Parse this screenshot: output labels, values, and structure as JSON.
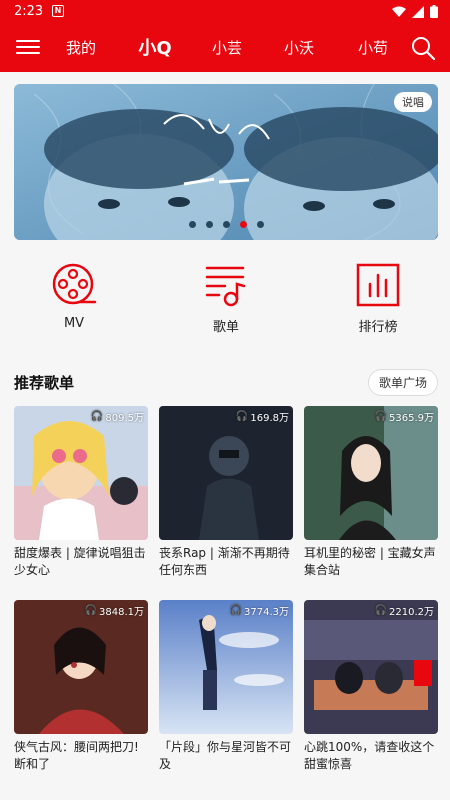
{
  "status": {
    "time": "2:23",
    "notif_glyph": "N"
  },
  "nav": {
    "tabs": [
      "我的",
      "小Q",
      "小芸",
      "小沃",
      "小苟"
    ],
    "active_tab": "小Q"
  },
  "banner": {
    "badge": "说唱",
    "dots": 5,
    "active_dot": 3
  },
  "quick_links": [
    {
      "label": "MV",
      "icon": "film-reel-icon"
    },
    {
      "label": "歌单",
      "icon": "playlist-icon"
    },
    {
      "label": "排行榜",
      "icon": "chart-icon"
    }
  ],
  "recommend": {
    "title": "推荐歌单",
    "more_label": "歌单广场",
    "playlists": [
      {
        "title": "甜度爆表 | 旋律说唱狙击少女心",
        "plays": "809.5万",
        "palette": [
          "#c8d6e8",
          "#e7c0c8"
        ]
      },
      {
        "title": "丧系Rap | 渐渐不再期待任何东西",
        "plays": "169.8万",
        "palette": [
          "#1d2430",
          "#3b4656"
        ]
      },
      {
        "title": "耳机里的秘密 | 宝藏女声集合站",
        "plays": "5365.9万",
        "palette": [
          "#3c5a4a",
          "#8ab0b8"
        ]
      },
      {
        "title": "侠气古风：腰间两把刀!断和了",
        "plays": "3848.1万",
        "palette": [
          "#5a2a22",
          "#b23030"
        ]
      },
      {
        "title": "「片段」你与星河皆不可及",
        "plays": "3774.3万",
        "palette": [
          "#5a80c8",
          "#d8e4f4"
        ]
      },
      {
        "title": "心跳100%，请查收这个甜蜜惊喜",
        "plays": "2210.2万",
        "palette": [
          "#3b3a52",
          "#c67a56"
        ]
      }
    ]
  },
  "colors": {
    "brand_red": "#e8070f"
  }
}
